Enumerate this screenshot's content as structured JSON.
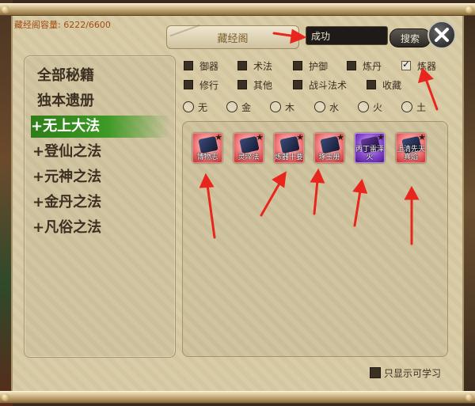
{
  "capacity_label": "藏经阁容量: 6222/6600",
  "title": "藏经阁",
  "search": {
    "value": "成功",
    "button": "搜索"
  },
  "categories": [
    {
      "label": "全部秘籍",
      "selected": false
    },
    {
      "label": "独本遗册",
      "selected": false
    },
    {
      "label": "+无上大法",
      "selected": true
    },
    {
      "label": "+登仙之法",
      "selected": false
    },
    {
      "label": "+元神之法",
      "selected": false
    },
    {
      "label": "+金丹之法",
      "selected": false
    },
    {
      "label": "+凡俗之法",
      "selected": false
    }
  ],
  "filters": [
    {
      "label": "御器",
      "checked": false
    },
    {
      "label": "术法",
      "checked": false
    },
    {
      "label": "护御",
      "checked": false
    },
    {
      "label": "炼丹",
      "checked": false
    },
    {
      "label": "炼器",
      "checked": true
    },
    {
      "label": "修行",
      "checked": false
    },
    {
      "label": "其他",
      "checked": false
    },
    {
      "label": "战斗法术",
      "checked": false
    },
    {
      "label": "收藏",
      "checked": false
    }
  ],
  "elements": [
    "无",
    "金",
    "木",
    "水",
    "火",
    "土"
  ],
  "items": [
    {
      "name": "博物志",
      "style": "red"
    },
    {
      "name": "灵淬法",
      "style": "red"
    },
    {
      "name": "炼器十要",
      "style": "red"
    },
    {
      "name": "琢玉册",
      "style": "red"
    },
    {
      "name": "丙丁雷泽火",
      "style": "purple"
    },
    {
      "name": "上清先天真焰",
      "style": "red"
    }
  ],
  "only_learnable": {
    "label": "只显示可学习",
    "checked": false
  },
  "colors": {
    "selected_green": "#3d9a24",
    "arrow_red": "#e8261e",
    "capacity_orange": "#a34a12"
  }
}
